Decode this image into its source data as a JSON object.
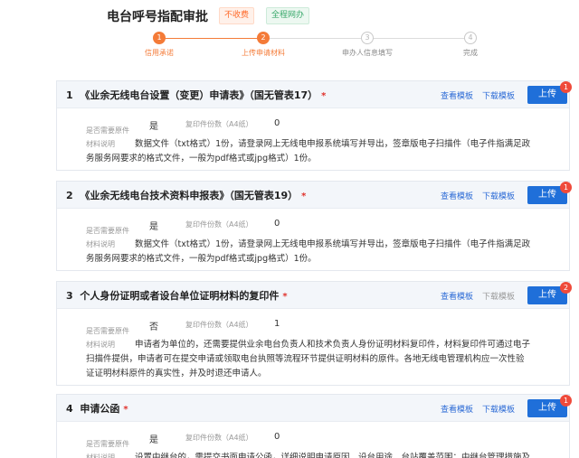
{
  "header": {
    "title": "电台呼号指配审批",
    "tag_fee": "不收费",
    "tag_online": "全程网办"
  },
  "steps": [
    {
      "num": "1",
      "label": "信用承诺",
      "state": "active"
    },
    {
      "num": "2",
      "label": "上传申请材料",
      "state": "active"
    },
    {
      "num": "3",
      "label": "申办人信息填写",
      "state": "todo"
    },
    {
      "num": "4",
      "label": "完成",
      "state": "todo"
    }
  ],
  "labels": {
    "need_original": "是否需要原件",
    "copies": "复印件份数（A4纸）",
    "desc": "材料说明",
    "view_template": "查看模板",
    "download_template": "下载模板",
    "upload": "上传",
    "required_mark": "*"
  },
  "colors": {
    "accent_orange": "#f47b38",
    "upload_blue": "#1f6fd9",
    "link_blue": "#2c6bd6",
    "badge_red": "#ef4a3a"
  },
  "materials": [
    {
      "index": "1",
      "title": "《业余无线电台设置（变更）申请表》（国无管表17）",
      "badge": "1",
      "download_enabled": true,
      "need_original": "是",
      "copies": "0",
      "desc_lines": [
        "数据文件（txt格式）1份，请登录网上无线电申报系统填写并导出，签章版电子扫描件（电子件指满足政",
        "务服务网要求的格式文件，一般为pdf格式或jpg格式）1份。"
      ]
    },
    {
      "index": "2",
      "title": "《业余无线电台技术资料申报表》（国无管表19）",
      "badge": "1",
      "download_enabled": true,
      "need_original": "是",
      "copies": "0",
      "desc_lines": [
        "数据文件（txt格式）1份，请登录网上无线电申报系统填写并导出，签章版电子扫描件（电子件指满足政",
        "务服务网要求的格式文件，一般为pdf格式或jpg格式）1份。"
      ]
    },
    {
      "index": "3",
      "title": "个人身份证明或者设台单位证明材料的复印件",
      "badge": "2",
      "download_enabled": false,
      "need_original": "否",
      "copies": "1",
      "desc_lines": [
        "申请者为单位的，还需要提供业余电台负责人和技术负责人身份证明材料复印件，材料复印件可通过电子",
        "扫描件提供，申请者可在提交申请或领取电台执照等流程环节提供证明材料的原件。各地无线电管理机构应一次性验",
        "证证明材料原件的真实性，并及时退还申请人。"
      ]
    },
    {
      "index": "4",
      "title": "申请公函",
      "badge": "1",
      "download_enabled": true,
      "need_original": "是",
      "copies": "0",
      "desc_lines": [
        "设置中继台的，需提交书面申请公函，详细说明申请原因、设台用途、台站覆盖范围；中继台管理措施及"
      ]
    }
  ]
}
